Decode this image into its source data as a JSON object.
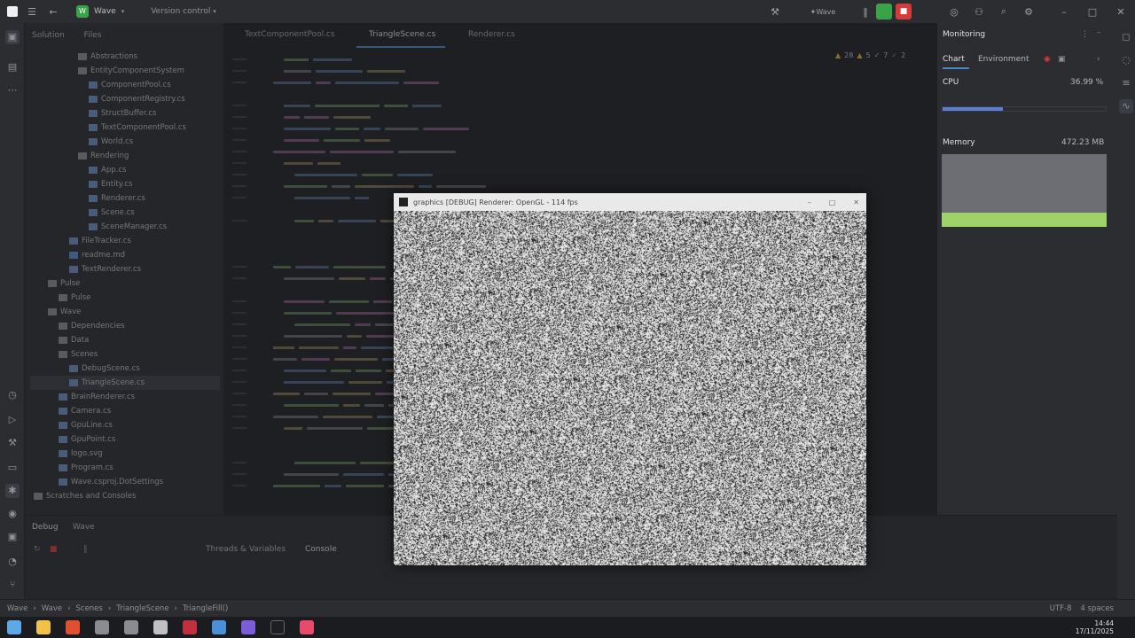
{
  "titlebar": {
    "project_name": "Wave",
    "vcs_label": "Version control"
  },
  "tabs": [
    {
      "label": "TextComponentPool.cs"
    },
    {
      "label": "TriangleScene.cs"
    },
    {
      "label": "Renderer.cs"
    }
  ],
  "solution_panel": {
    "tab_solution": "Solution",
    "tab_files": "Files",
    "tree": [
      {
        "label": "Abstractions",
        "kind": "folder"
      },
      {
        "label": "EntityComponentSystem",
        "kind": "folder"
      },
      {
        "label": "ComponentPool.cs",
        "kind": "cs"
      },
      {
        "label": "ComponentRegistry.cs",
        "kind": "cs"
      },
      {
        "label": "StructBuffer.cs",
        "kind": "cs"
      },
      {
        "label": "TextComponentPool.cs",
        "kind": "cs"
      },
      {
        "label": "World.cs",
        "kind": "cs"
      },
      {
        "label": "Rendering",
        "kind": "folder"
      },
      {
        "label": "App.cs",
        "kind": "cs"
      },
      {
        "label": "Entity.cs",
        "kind": "cs"
      },
      {
        "label": "Renderer.cs",
        "kind": "cs"
      },
      {
        "label": "Scene.cs",
        "kind": "cs"
      },
      {
        "label": "SceneManager.cs",
        "kind": "cs"
      },
      {
        "label": "FileTracker.cs",
        "kind": "cs"
      },
      {
        "label": "readme.md",
        "kind": "md"
      },
      {
        "label": "TextRenderer.cs",
        "kind": "cs"
      },
      {
        "label": "Pulse",
        "kind": "folder"
      },
      {
        "label": "Pulse",
        "kind": "folder"
      },
      {
        "label": "Wave",
        "kind": "folder"
      },
      {
        "label": "Dependencies",
        "kind": "folder"
      },
      {
        "label": "Data",
        "kind": "folder"
      },
      {
        "label": "Scenes",
        "kind": "folder"
      },
      {
        "label": "DebugScene.cs",
        "kind": "cs"
      },
      {
        "label": "TriangleScene.cs",
        "kind": "cs"
      },
      {
        "label": "BrainRenderer.cs",
        "kind": "cs"
      },
      {
        "label": "Camera.cs",
        "kind": "cs"
      },
      {
        "label": "GpuLine.cs",
        "kind": "cs"
      },
      {
        "label": "GpuPoint.cs",
        "kind": "cs"
      },
      {
        "label": "logo.svg",
        "kind": "cs"
      },
      {
        "label": "Program.cs",
        "kind": "cs"
      },
      {
        "label": "Wave.csproj.DotSettings",
        "kind": "cs"
      },
      {
        "label": "Scratches and Consoles",
        "kind": "folder"
      }
    ]
  },
  "debug_panel": {
    "title": "Debug",
    "config": "Wave",
    "tab_threads": "Threads & Variables",
    "tab_console": "Console"
  },
  "monitoring": {
    "title": "Monitoring",
    "tab_chart": "Chart",
    "tab_environment": "Environment",
    "cpu_label": "CPU",
    "cpu_value": "36.99 %",
    "cpu_level": 0.37,
    "memory_label": "Memory",
    "memory_value": "472.23 MB"
  },
  "editor": {
    "inspections": {
      "warnings": "28",
      "weak": "5",
      "hints": "7",
      "typos": "2"
    }
  },
  "breadcrumb": [
    "Wave",
    "Wave",
    "Scenes",
    "TriangleScene",
    "TriangleFill()"
  ],
  "status": {
    "encoding": "UTF-8",
    "indent": "4 spaces"
  },
  "game_window": {
    "title": "graphics [DEBUG] Renderer: OpenGL - 114 fps"
  },
  "taskbar": {
    "time": "14:44",
    "date": "17/11/2025"
  },
  "colors": {
    "accent_green": "#3aa34a",
    "cpu_bar": "#5b7fd6",
    "memory_fill": "#9fd36a"
  }
}
